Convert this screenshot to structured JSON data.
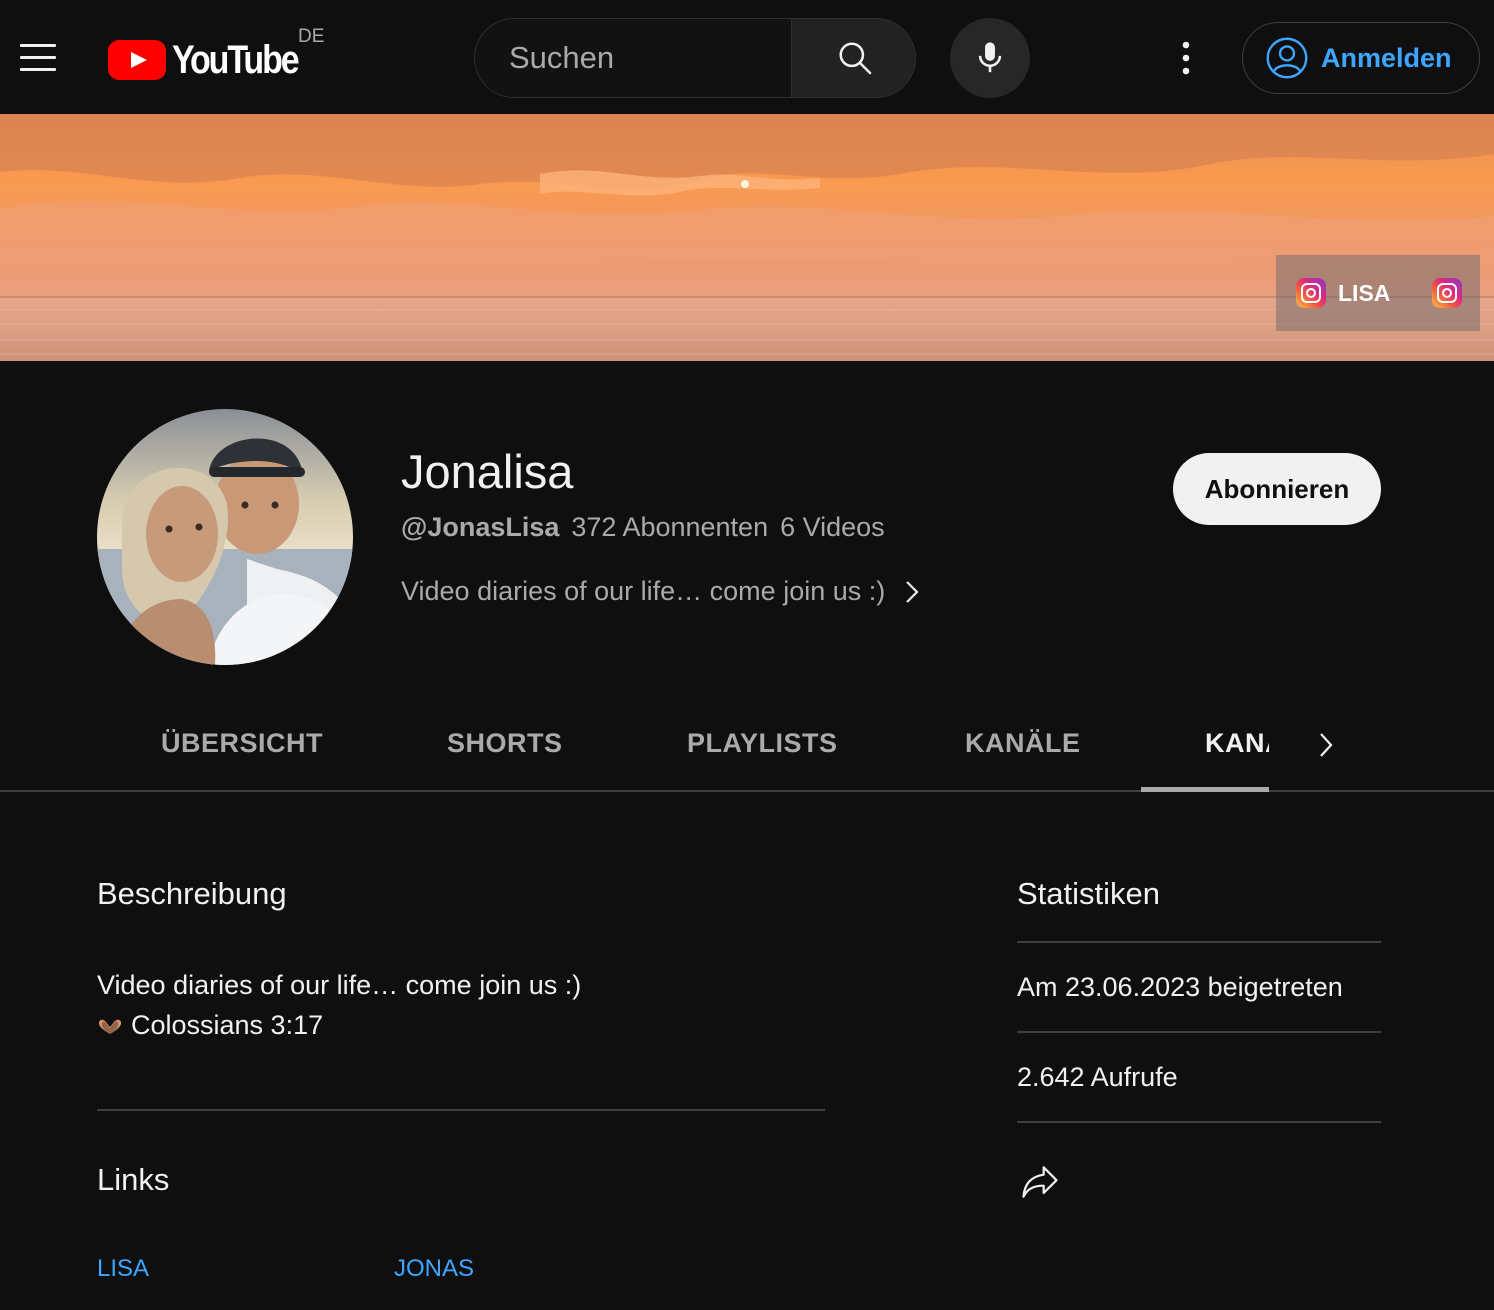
{
  "masthead": {
    "logo_text": "YouTube",
    "region": "DE",
    "search_placeholder": "Suchen",
    "signin_label": "Anmelden",
    "icons": [
      "menu-icon",
      "search-icon",
      "microphone-icon",
      "more-vert-icon",
      "account-circle-icon"
    ]
  },
  "banner": {
    "link_label": "LISA",
    "icons": [
      "instagram-icon",
      "instagram-icon"
    ]
  },
  "channel": {
    "name": "Jonalisa",
    "handle": "@JonasLisa",
    "subscribers": "372 Abonnenten",
    "videos": "6 Videos",
    "tagline": "Video diaries of our life… come join us :)",
    "subscribe_label": "Abonnieren"
  },
  "tabs": [
    {
      "label": "ÜBERSICHT",
      "active": false
    },
    {
      "label": "SHORTS",
      "active": false
    },
    {
      "label": "PLAYLISTS",
      "active": false
    },
    {
      "label": "KANÄLE",
      "active": false
    },
    {
      "label": "KANALINFO",
      "active": true
    }
  ],
  "about": {
    "description_title": "Beschreibung",
    "description_lines": [
      "Video diaries of our life… come join us :)",
      "Colossians 3:17"
    ],
    "description_emoji": "heart-hands-icon",
    "links_title": "Links",
    "links": [
      "LISA",
      "JONAS"
    ],
    "stats_title": "Statistiken",
    "joined": "Am 23.06.2023 beigetreten",
    "views": "2.642 Aufrufe",
    "share_icon": "share-icon"
  },
  "colors": {
    "background": "#0f0f0f",
    "text": "#f1f1f1",
    "secondary_text": "#aaaaaa",
    "link": "#3ea6ff",
    "youtube_red": "#ff0000",
    "subscribe_bg": "#f1f1f1"
  }
}
